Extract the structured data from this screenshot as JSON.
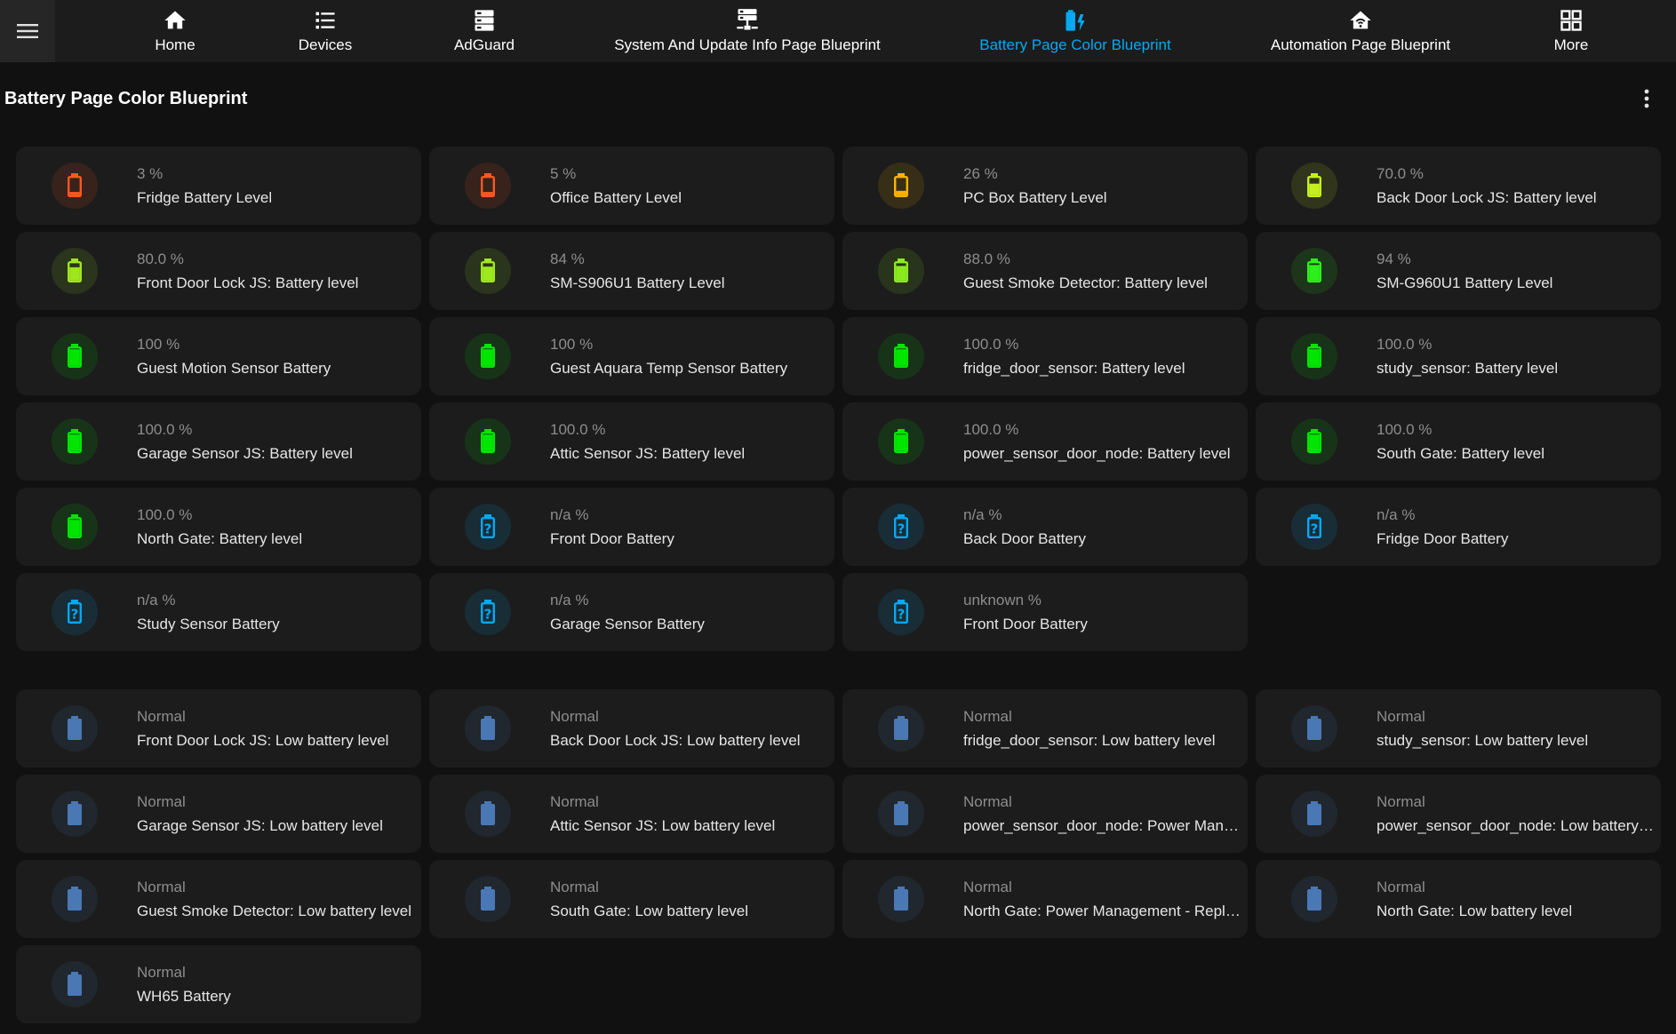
{
  "nav": {
    "tabs": [
      {
        "label": "Home",
        "icon": "home-icon",
        "active": false
      },
      {
        "label": "Devices",
        "icon": "list-icon",
        "active": false
      },
      {
        "label": "AdGuard",
        "icon": "server-icon",
        "active": false
      },
      {
        "label": "System And Update Info Page Blueprint",
        "icon": "server-network-icon",
        "active": false
      },
      {
        "label": "Battery Page Color Blueprint",
        "icon": "battery-charging-icon",
        "active": true
      },
      {
        "label": "Automation Page Blueprint",
        "icon": "home-automation-icon",
        "active": false
      },
      {
        "label": "More",
        "icon": "grid-icon",
        "active": false
      }
    ]
  },
  "page": {
    "title": "Battery Page Color Blueprint"
  },
  "colors": {
    "background": "#111111",
    "tile": "#1c1c1c",
    "accent": "#03a9f4",
    "critical": "#ff5722",
    "low": "#ffb300",
    "medium": "#c6ef1f",
    "good": "#8bc34a",
    "full": "#00e600",
    "unknown": "#03a9f4",
    "normal": "#4a78b5"
  },
  "battery_levels": {
    "items": [
      {
        "state": "3 %",
        "name": "Fridge Battery Level",
        "color": "#ff5722",
        "level": 0.03,
        "icon": "battery-alert-icon"
      },
      {
        "state": "5 %",
        "name": "Office Battery Level",
        "color": "#ff5722",
        "level": 0.05,
        "icon": "battery-alert-icon"
      },
      {
        "state": "26 %",
        "name": "PC Box Battery Level",
        "color": "#ffb300",
        "level": 0.26,
        "icon": "battery-low-icon"
      },
      {
        "state": "70.0 %",
        "name": "Back Door Lock JS: Battery level",
        "color": "#c6ef1f",
        "level": 0.7,
        "icon": "battery-70-icon"
      },
      {
        "state": "80.0 %",
        "name": "Front Door Lock JS: Battery level",
        "color": "#a0e51f",
        "level": 0.8,
        "icon": "battery-80-icon"
      },
      {
        "state": "84 %",
        "name": "SM-S906U1 Battery Level",
        "color": "#9ee81f",
        "level": 0.84,
        "icon": "battery-80-icon"
      },
      {
        "state": "88.0 %",
        "name": "Guest Smoke Detector: Battery level",
        "color": "#8bea1f",
        "level": 0.88,
        "icon": "battery-90-icon"
      },
      {
        "state": "94 %",
        "name": "SM-G960U1 Battery Level",
        "color": "#2cf01a",
        "level": 0.94,
        "icon": "battery-90-icon"
      },
      {
        "state": "100 %",
        "name": "Guest Motion Sensor Battery",
        "color": "#00e600",
        "level": 1.0,
        "icon": "battery-full-icon"
      },
      {
        "state": "100 %",
        "name": "Guest Aquara Temp Sensor Battery",
        "color": "#00e600",
        "level": 1.0,
        "icon": "battery-full-icon"
      },
      {
        "state": "100.0 %",
        "name": "fridge_door_sensor: Battery level",
        "color": "#00e600",
        "level": 1.0,
        "icon": "battery-full-icon"
      },
      {
        "state": "100.0 %",
        "name": "study_sensor: Battery level",
        "color": "#00e600",
        "level": 1.0,
        "icon": "battery-full-icon"
      },
      {
        "state": "100.0 %",
        "name": "Garage Sensor JS: Battery level",
        "color": "#00e600",
        "level": 1.0,
        "icon": "battery-full-icon"
      },
      {
        "state": "100.0 %",
        "name": "Attic Sensor JS: Battery level",
        "color": "#00e600",
        "level": 1.0,
        "icon": "battery-full-icon"
      },
      {
        "state": "100.0 %",
        "name": "power_sensor_door_node: Battery level",
        "color": "#00e600",
        "level": 1.0,
        "icon": "battery-full-icon"
      },
      {
        "state": "100.0 %",
        "name": "South Gate: Battery level",
        "color": "#00e600",
        "level": 1.0,
        "icon": "battery-full-icon"
      },
      {
        "state": "100.0 %",
        "name": "North Gate: Battery level",
        "color": "#00e600",
        "level": 1.0,
        "icon": "battery-full-icon"
      },
      {
        "state": "n/a %",
        "name": "Front Door Battery",
        "color": "#03a9f4",
        "level": null,
        "icon": "battery-unknown-icon"
      },
      {
        "state": "n/a %",
        "name": "Back Door Battery",
        "color": "#03a9f4",
        "level": null,
        "icon": "battery-unknown-icon"
      },
      {
        "state": "n/a %",
        "name": "Fridge Door Battery",
        "color": "#03a9f4",
        "level": null,
        "icon": "battery-unknown-icon"
      },
      {
        "state": "n/a %",
        "name": "Study Sensor Battery",
        "color": "#03a9f4",
        "level": null,
        "icon": "battery-unknown-icon"
      },
      {
        "state": "n/a %",
        "name": "Garage Sensor Battery",
        "color": "#03a9f4",
        "level": null,
        "icon": "battery-unknown-icon"
      },
      {
        "state": "unknown %",
        "name": "Front Door Battery",
        "color": "#03a9f4",
        "level": null,
        "icon": "battery-unknown-icon"
      }
    ]
  },
  "low_battery_sensors": {
    "items": [
      {
        "state": "Normal",
        "name": "Front Door Lock JS: Low battery level",
        "color": "#4a78b5",
        "icon": "battery-icon"
      },
      {
        "state": "Normal",
        "name": "Back Door Lock JS: Low battery level",
        "color": "#4a78b5",
        "icon": "battery-icon"
      },
      {
        "state": "Normal",
        "name": "fridge_door_sensor: Low battery level",
        "color": "#4a78b5",
        "icon": "battery-icon"
      },
      {
        "state": "Normal",
        "name": "study_sensor: Low battery level",
        "color": "#4a78b5",
        "icon": "battery-icon"
      },
      {
        "state": "Normal",
        "name": "Garage Sensor JS: Low battery level",
        "color": "#4a78b5",
        "icon": "battery-icon"
      },
      {
        "state": "Normal",
        "name": "Attic Sensor JS: Low battery level",
        "color": "#4a78b5",
        "icon": "battery-icon"
      },
      {
        "state": "Normal",
        "name": "power_sensor_door_node: Power Management - Replace battery soon",
        "color": "#4a78b5",
        "icon": "battery-icon"
      },
      {
        "state": "Normal",
        "name": "power_sensor_door_node: Low battery level",
        "color": "#4a78b5",
        "icon": "battery-icon"
      },
      {
        "state": "Normal",
        "name": "Guest Smoke Detector: Low battery level",
        "color": "#4a78b5",
        "icon": "battery-icon"
      },
      {
        "state": "Normal",
        "name": "South Gate: Low battery level",
        "color": "#4a78b5",
        "icon": "battery-icon"
      },
      {
        "state": "Normal",
        "name": "North Gate: Power Management - Replace battery soon",
        "color": "#4a78b5",
        "icon": "battery-icon"
      },
      {
        "state": "Normal",
        "name": "North Gate: Low battery level",
        "color": "#4a78b5",
        "icon": "battery-icon"
      },
      {
        "state": "Normal",
        "name": "WH65 Battery",
        "color": "#4a78b5",
        "icon": "battery-icon"
      }
    ]
  }
}
